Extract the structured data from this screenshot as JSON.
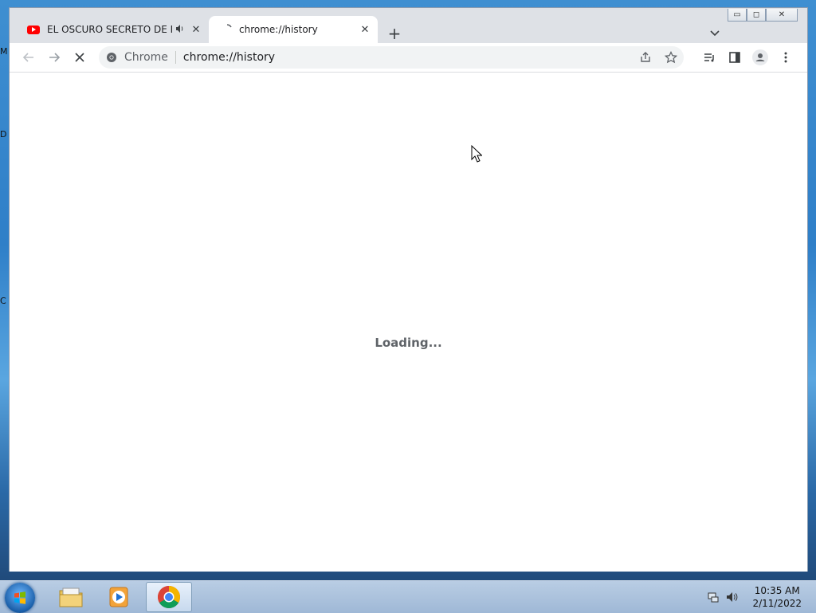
{
  "desktop": {
    "edge_letters": [
      "M",
      "D",
      "C"
    ]
  },
  "window": {
    "caption": {
      "minimize": "▭",
      "maximize": "◻",
      "close": "✕"
    },
    "tabs": [
      {
        "title": "EL OSCURO SECRETO DE MI",
        "favicon": "youtube-icon",
        "audio": "speaker-icon",
        "close": "✕",
        "active": false
      },
      {
        "title": "chrome://history",
        "favicon": "loading-spinner-icon",
        "close": "✕",
        "active": true
      }
    ],
    "new_tab": "+",
    "toolbar": {
      "back": "←",
      "forward": "→",
      "stop": "✕",
      "omnibox": {
        "chip": "Chrome",
        "url": "chrome://history"
      }
    },
    "content": {
      "loading_text": "Loading..."
    }
  },
  "taskbar": {
    "clock": {
      "time": "10:35 AM",
      "date": "2/11/2022"
    },
    "apps": [
      "file-explorer-icon",
      "media-player-icon",
      "chrome-icon"
    ]
  }
}
